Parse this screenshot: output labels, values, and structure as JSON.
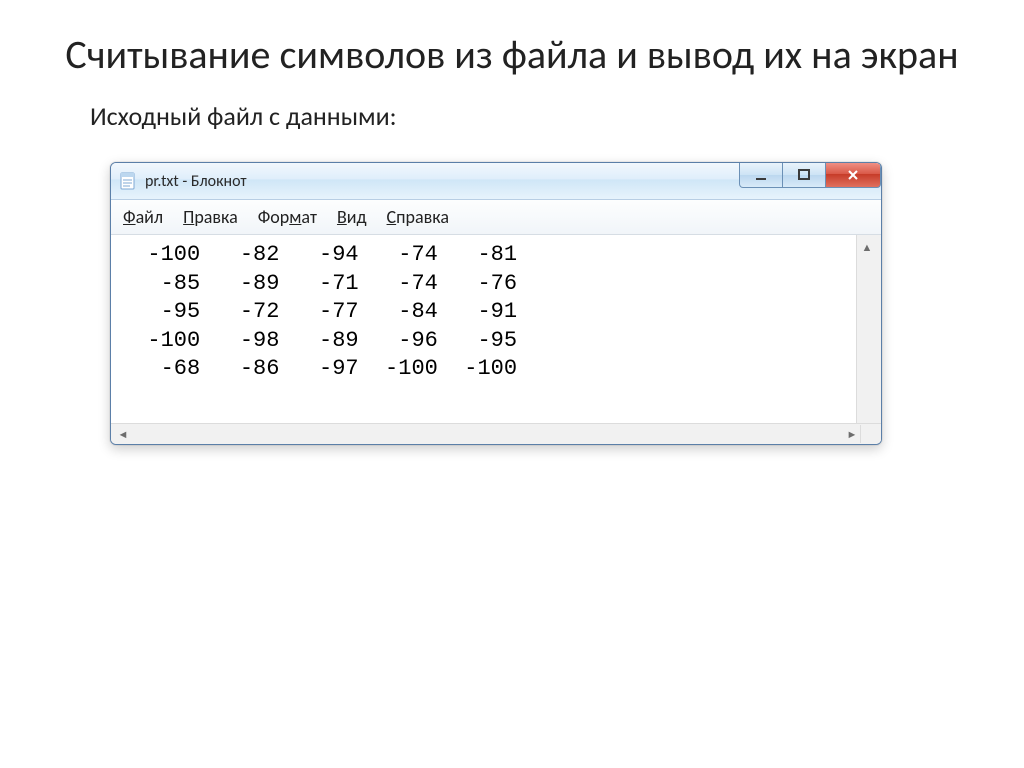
{
  "slide": {
    "title": "Считывание символов из файла и вывод их на экран",
    "subtitle": "Исходный файл с данными:"
  },
  "window": {
    "title": "pr.txt - Блокнот"
  },
  "menu": {
    "items": [
      {
        "pre": "",
        "ul": "Ф",
        "post": "айл"
      },
      {
        "pre": "",
        "ul": "П",
        "post": "равка"
      },
      {
        "pre": "Фор",
        "ul": "м",
        "post": "ат"
      },
      {
        "pre": "",
        "ul": "В",
        "post": "ид"
      },
      {
        "pre": "",
        "ul": "С",
        "post": "правка"
      }
    ]
  },
  "content": {
    "rows": [
      [
        "-100",
        "-82",
        "-94",
        "-74",
        "-81"
      ],
      [
        "-85",
        "-89",
        "-71",
        "-74",
        "-76"
      ],
      [
        "-95",
        "-72",
        "-77",
        "-84",
        "-91"
      ],
      [
        "-100",
        "-98",
        "-89",
        "-96",
        "-95"
      ],
      [
        "-68",
        "-86",
        "-97",
        "-100",
        "-100"
      ]
    ]
  }
}
